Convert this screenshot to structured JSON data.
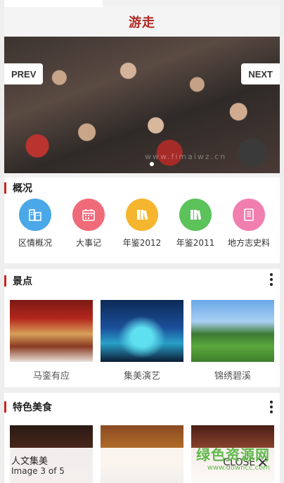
{
  "header": {
    "title": "游走"
  },
  "hero": {
    "prev_label": "PREV",
    "next_label": "NEXT",
    "watermark": "www.fimaiwz.cn"
  },
  "overview": {
    "title": "概况",
    "items": [
      {
        "label": "区情概况",
        "icon": "buildings-icon",
        "color": "#4aa8e8"
      },
      {
        "label": "大事记",
        "icon": "calendar-icon",
        "color": "#f06b7a"
      },
      {
        "label": "年鉴2012",
        "icon": "books-icon",
        "color": "#f6b52e"
      },
      {
        "label": "年鉴2011",
        "icon": "books-icon",
        "color": "#5cc25a"
      },
      {
        "label": "地方志史料",
        "icon": "document-icon",
        "color": "#f07fb0"
      }
    ]
  },
  "scenery": {
    "title": "景点",
    "items": [
      {
        "label": "马銮有应"
      },
      {
        "label": "集美演艺"
      },
      {
        "label": "锦绣碧溪"
      }
    ]
  },
  "food": {
    "title": "特色美食"
  },
  "lightbox": {
    "caption": "人文集美",
    "counter": "Image 3 of 5",
    "close_label": "CLOSE"
  },
  "watermark": {
    "brand": "绿色资源网",
    "url": "www.downcc.com"
  }
}
